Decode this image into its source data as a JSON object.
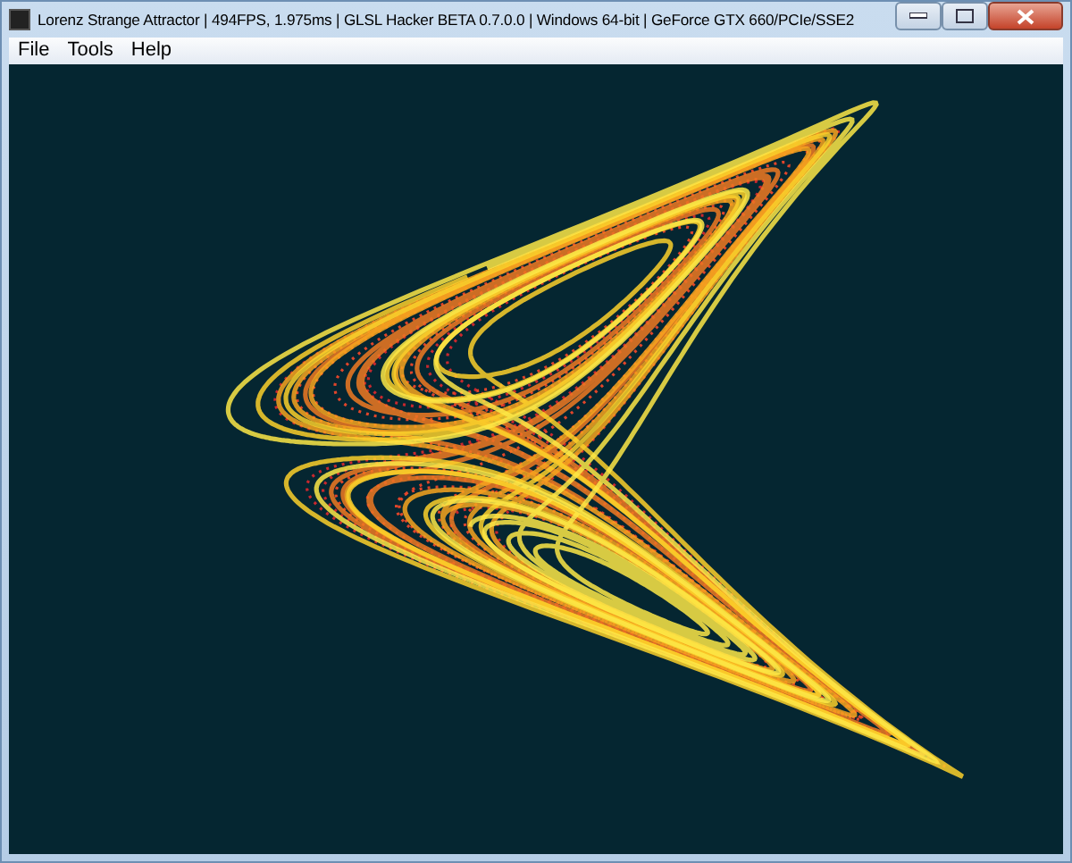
{
  "window": {
    "title": "Lorenz Strange Attractor | 494FPS, 1.975ms | GLSL Hacker BETA 0.7.0.0 | Windows 64-bit | GeForce GTX 660/PCIe/SSE2"
  },
  "menu": [
    {
      "label": "File"
    },
    {
      "label": "Tools"
    },
    {
      "label": "Help"
    }
  ]
}
